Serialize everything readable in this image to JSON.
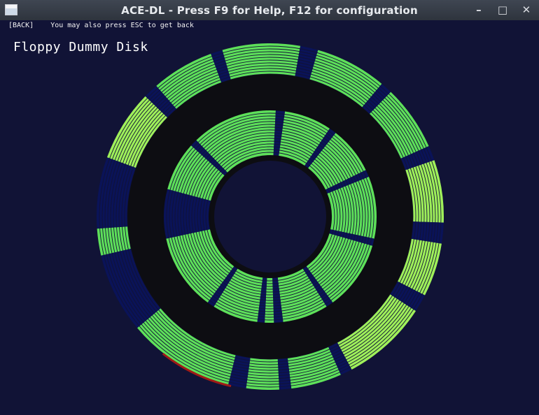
{
  "window": {
    "title": "ACE-DL - Press F9 for Help, F12 for configuration",
    "minimize_glyph": "–",
    "maximize_glyph": "□",
    "close_glyph": "✕"
  },
  "header": {
    "back_label": "[BACK]",
    "back_hint": "You may also press ESC to get back"
  },
  "disk": {
    "title": "Floppy Dummy Disk",
    "colors": {
      "background": "#111336",
      "gap": "#0d0d12",
      "sector_good": "#5ee05a",
      "sector_light": "#9ff05a",
      "sector_empty": "#0a1358",
      "sector_error": "#a01b16"
    }
  },
  "icons": {
    "app": "window-icon",
    "minimize": "minimize-icon",
    "maximize": "maximize-icon",
    "close": "close-icon"
  }
}
